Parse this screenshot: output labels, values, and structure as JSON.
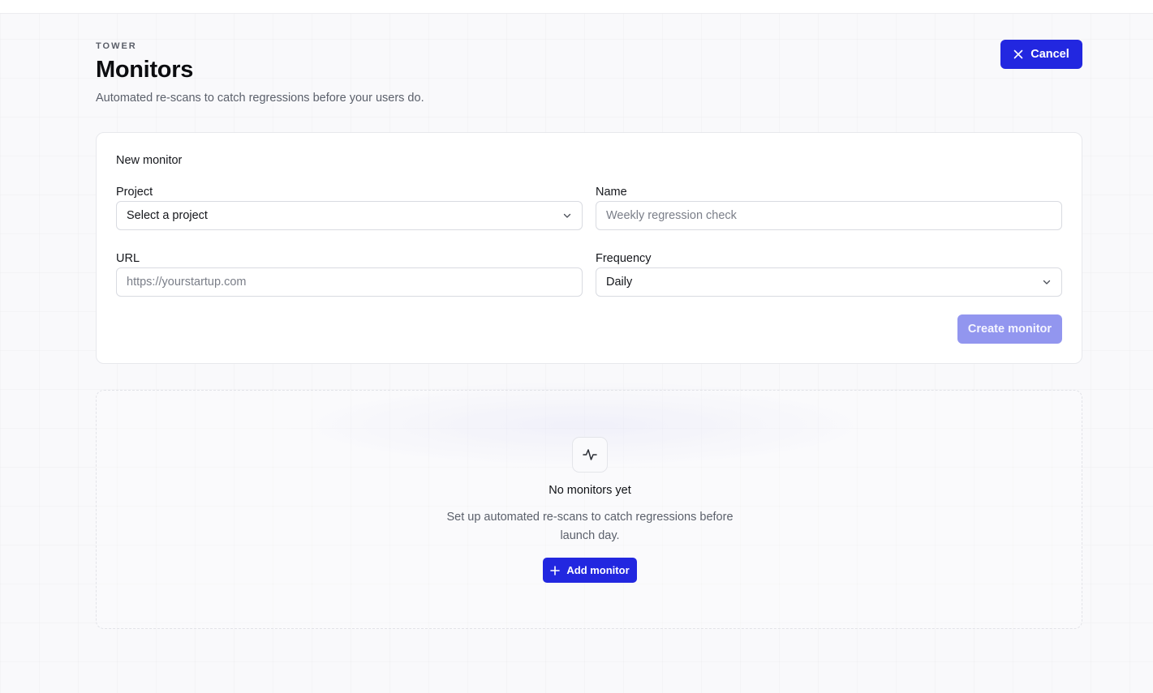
{
  "header": {
    "eyebrow": "TOWER",
    "title": "Monitors",
    "subtitle": "Automated re-scans to catch regressions before your users do.",
    "cancel_label": "Cancel"
  },
  "form": {
    "title": "New monitor",
    "project": {
      "label": "Project",
      "value": "Select a project"
    },
    "name": {
      "label": "Name",
      "placeholder": "Weekly regression check"
    },
    "url": {
      "label": "URL",
      "placeholder": "https://yourstartup.com"
    },
    "frequency": {
      "label": "Frequency",
      "value": "Daily"
    },
    "submit_label": "Create monitor"
  },
  "empty_state": {
    "icon": "activity-icon",
    "title": "No monitors yet",
    "description": "Set up automated re-scans to catch regressions before launch day.",
    "button_label": "Add monitor"
  },
  "colors": {
    "accent": "#2227e0",
    "accent_disabled": "#9296ef",
    "background": "#f9f9fb"
  }
}
